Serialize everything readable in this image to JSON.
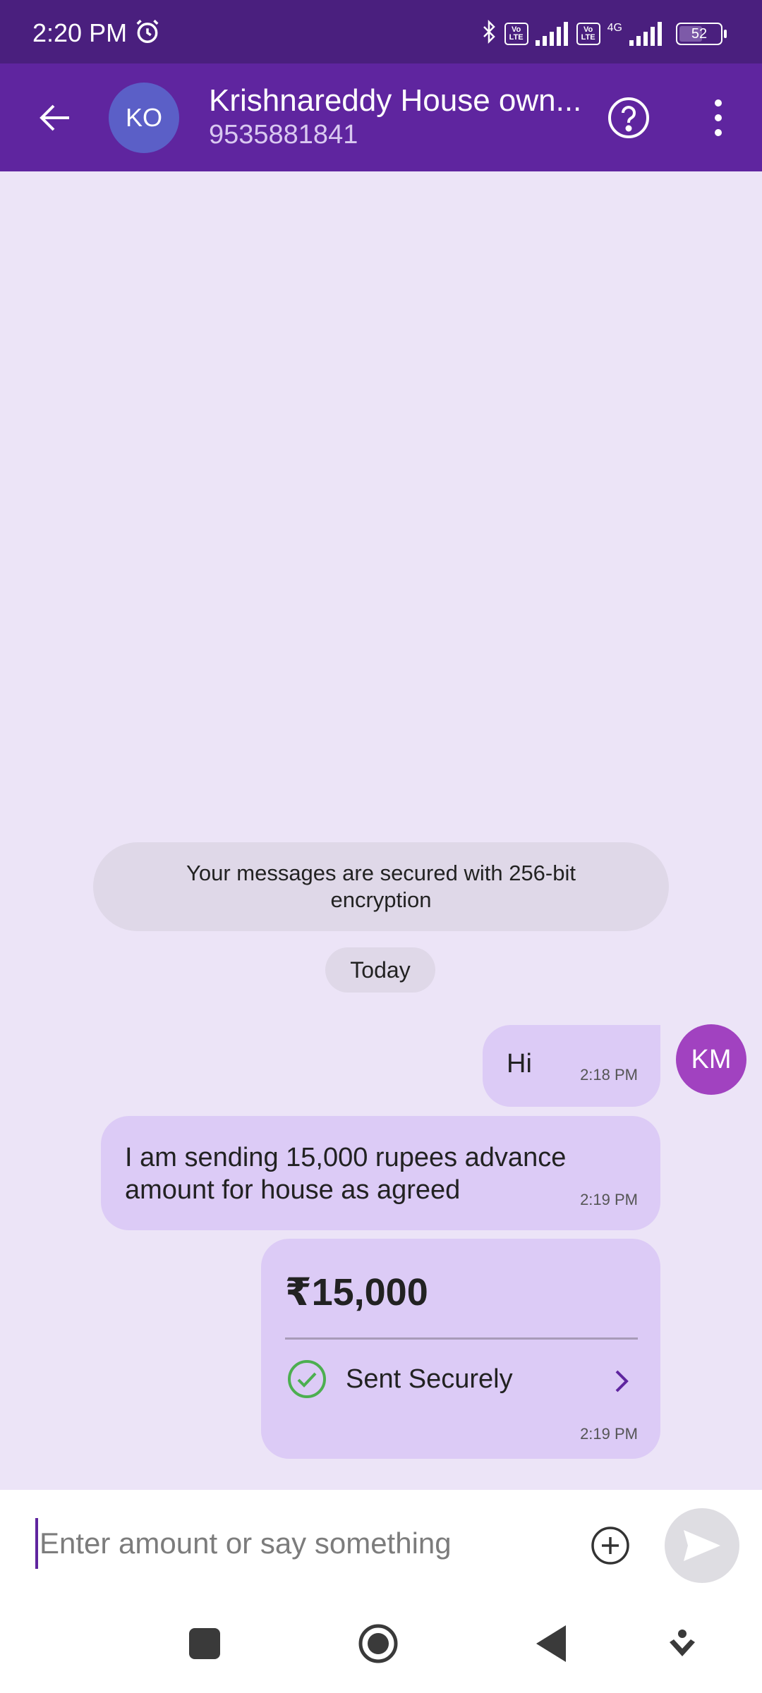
{
  "status_bar": {
    "time": "2:20 PM",
    "battery_level": "52",
    "network_label": "4G",
    "volte_label_top": "Vo",
    "volte_label_bottom": "LTE"
  },
  "header": {
    "avatar_initials": "KO",
    "contact_name": "Krishnareddy House own...",
    "contact_phone": "9535881841"
  },
  "chat": {
    "encryption_notice": "Your messages are secured with 256-bit encryption",
    "date_chip": "Today",
    "sender_initials": "KM",
    "messages": [
      {
        "text": "Hi",
        "time": "2:18 PM"
      },
      {
        "text": "I am sending 15,000 rupees advance amount for house as agreed",
        "time": "2:19 PM"
      }
    ],
    "payment": {
      "amount": "₹15,000",
      "status": "Sent Securely",
      "time": "2:19 PM"
    }
  },
  "composer": {
    "placeholder": "Enter amount or say something"
  },
  "colors": {
    "appbar": "#5f259f",
    "statusbar": "#4a1f7e",
    "background": "#ece4f7",
    "bubble": "#dccbf6",
    "success": "#4caf50"
  },
  "icons": [
    "alarm-icon",
    "bluetooth-icon",
    "signal-icon",
    "battery-icon",
    "back-arrow-icon",
    "help-icon",
    "more-vertical-icon",
    "check-circle-icon",
    "chevron-right-icon",
    "add-circle-icon",
    "send-icon"
  ]
}
